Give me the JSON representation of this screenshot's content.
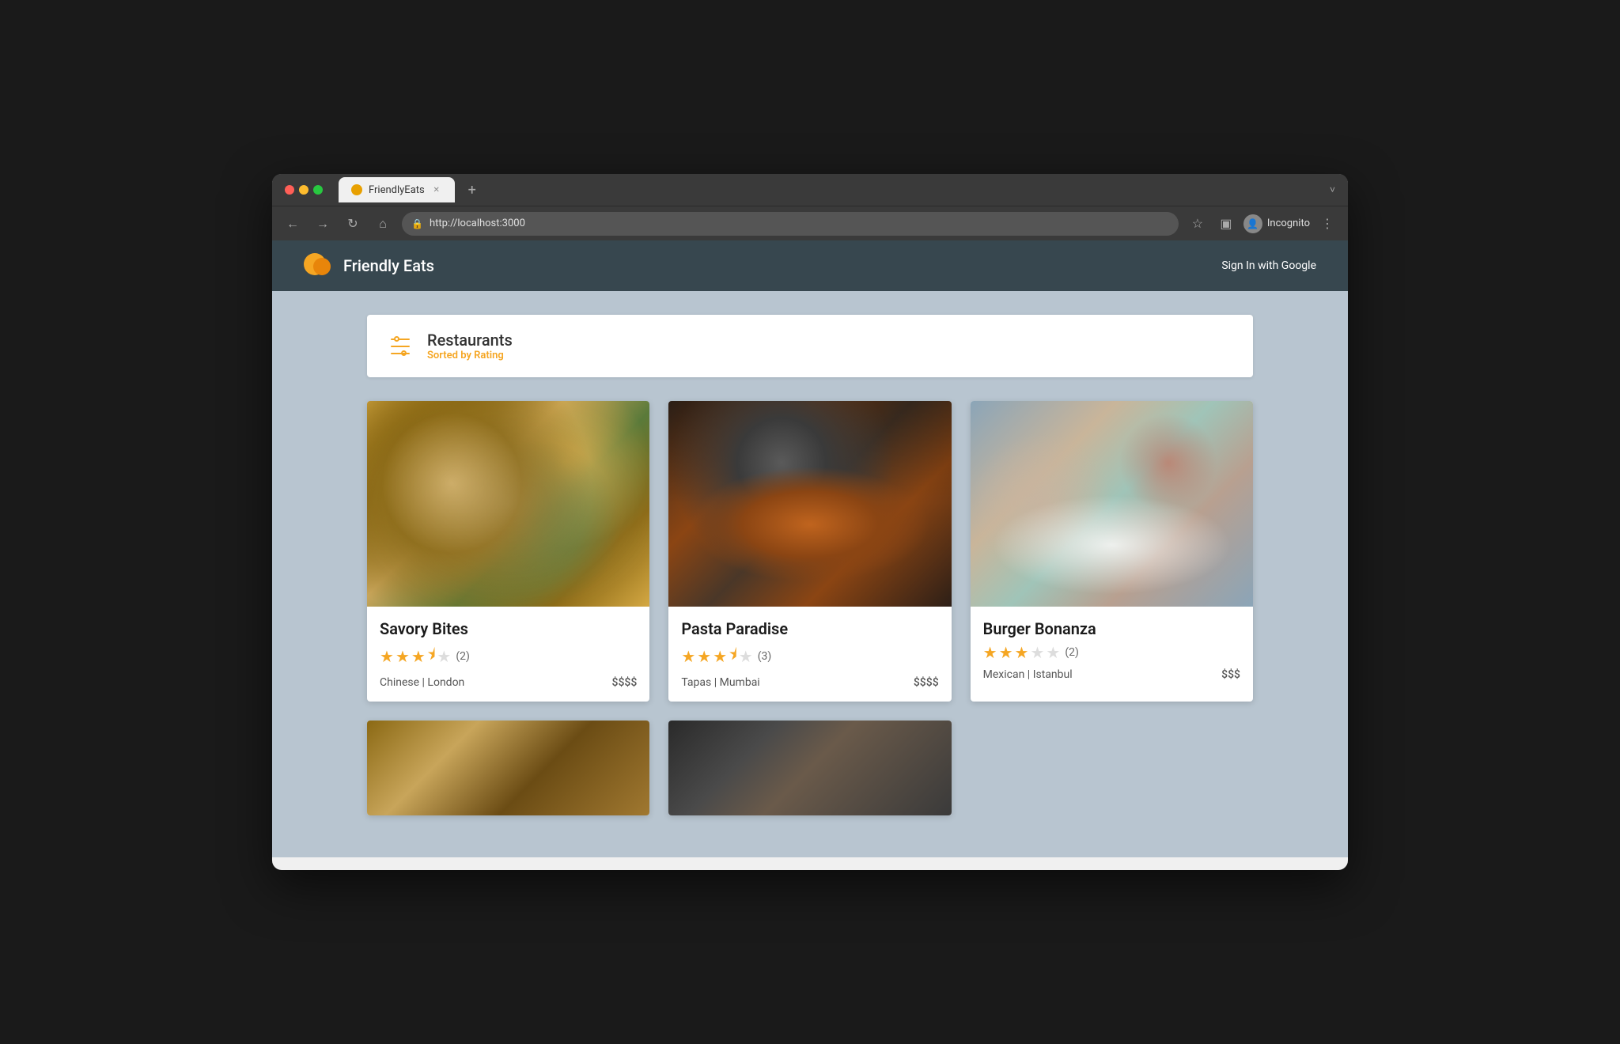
{
  "browser": {
    "tab_label": "FriendlyEats",
    "tab_new": "+",
    "url": "http://localhost:3000",
    "back_icon": "←",
    "forward_icon": "→",
    "refresh_icon": "↻",
    "home_icon": "⌂",
    "lock_icon": "🔒",
    "star_icon": "☆",
    "incognito_label": "Incognito",
    "menu_icon": "⋮",
    "reader_icon": "▣",
    "tab_expand": "˅"
  },
  "app": {
    "title": "Friendly Eats",
    "sign_in_label": "Sign In with Google",
    "header_bg": "#37474f"
  },
  "restaurants_section": {
    "title": "Restaurants",
    "subtitle": "Sorted by Rating",
    "filter_label": "filter-icon"
  },
  "restaurants": [
    {
      "id": "savory-bites",
      "name": "Savory Bites",
      "rating": 3.5,
      "stars_full": 3,
      "stars_half": 1,
      "review_count": "(2)",
      "cuisine": "Chinese",
      "location": "London",
      "price": "$$$$",
      "image_class": "img-savory-bites"
    },
    {
      "id": "pasta-paradise",
      "name": "Pasta Paradise",
      "rating": 3.5,
      "stars_full": 3,
      "stars_half": 1,
      "review_count": "(3)",
      "cuisine": "Tapas",
      "location": "Mumbai",
      "price": "$$$$",
      "image_class": "img-pasta-paradise"
    },
    {
      "id": "burger-bonanza",
      "name": "Burger Bonanza",
      "rating": 3,
      "stars_full": 3,
      "stars_half": 0,
      "review_count": "(2)",
      "cuisine": "Mexican",
      "location": "Istanbul",
      "price": "$$$",
      "image_class": "img-burger-bonanza"
    },
    {
      "id": "fourth-restaurant",
      "name": "",
      "rating": 0,
      "stars_full": 0,
      "stars_half": 0,
      "review_count": "",
      "cuisine": "",
      "location": "",
      "price": "",
      "image_class": "img-fourth"
    },
    {
      "id": "fifth-restaurant",
      "name": "",
      "rating": 0,
      "stars_full": 0,
      "stars_half": 0,
      "review_count": "",
      "cuisine": "",
      "location": "",
      "price": "",
      "image_class": "img-fifth"
    }
  ]
}
